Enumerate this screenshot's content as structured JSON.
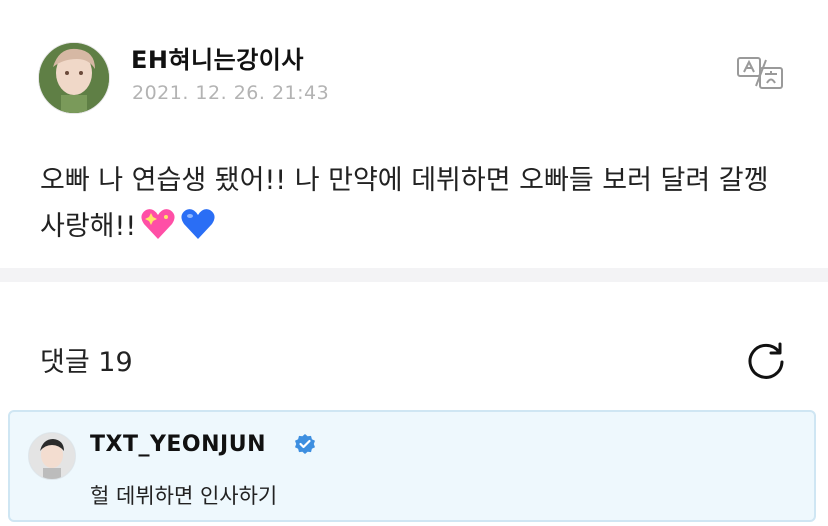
{
  "post": {
    "author_name": "EH혀니는강이사",
    "date": "2021. 12. 26. 21:43",
    "text": "오빠 나 연습생 됐어!! 나 만약에 데뷔하면 오빠들 보러 달려 갈껭 사랑해!!",
    "emojis": [
      "sparkling-heart",
      "blue-heart"
    ]
  },
  "comments": {
    "title": "댓글 19"
  },
  "highlighted_comment": {
    "author": "TXT_YEONJUN",
    "text": "헐 데뷔하면 인사하기",
    "verified": true
  },
  "colors": {
    "accent_blue": "#3d8fe0",
    "date_gray": "#b3b3b3",
    "card_bg": "#eef8fd",
    "divider": "#f3f3f5"
  },
  "icons": {
    "translate": "translate-icon",
    "refresh": "refresh-icon",
    "verified": "verified-badge-icon"
  }
}
